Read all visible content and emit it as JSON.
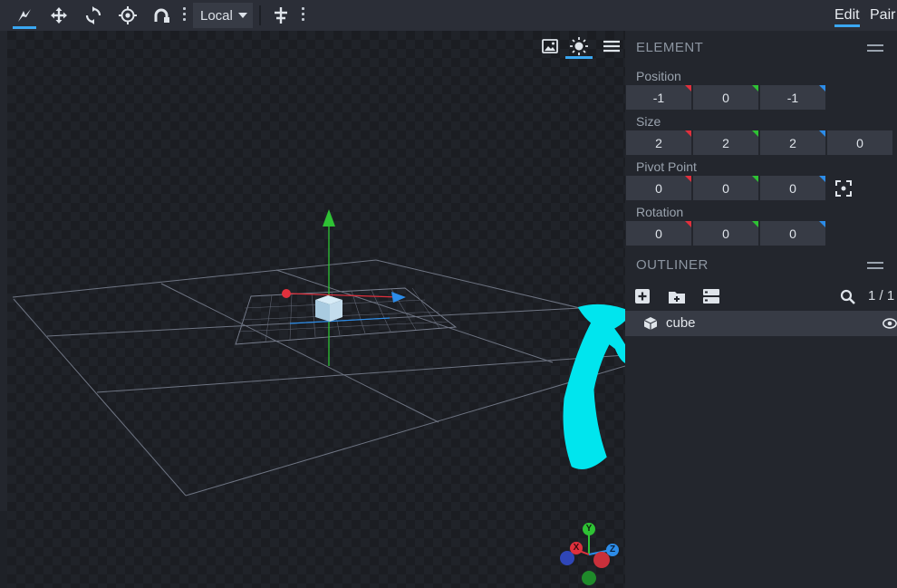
{
  "toolbar": {
    "tools": [
      {
        "name": "vertex-snap-tool"
      },
      {
        "name": "move-tool"
      },
      {
        "name": "rotate-tool"
      },
      {
        "name": "pivot-tool"
      },
      {
        "name": "resize-tool"
      }
    ],
    "space_select": "Local",
    "modes": [
      {
        "label": "Edit",
        "active": true
      },
      {
        "label": "Pair",
        "active": false
      }
    ]
  },
  "element_panel": {
    "title": "ELEMENT",
    "position": {
      "label": "Position",
      "values": [
        "-1",
        "0",
        "-1"
      ]
    },
    "size": {
      "label": "Size",
      "values": [
        "2",
        "2",
        "2",
        "0"
      ]
    },
    "pivot": {
      "label": "Pivot Point",
      "values": [
        "0",
        "0",
        "0"
      ]
    },
    "rotation": {
      "label": "Rotation",
      "values": [
        "0",
        "0",
        "0"
      ]
    }
  },
  "outliner": {
    "title": "OUTLINER",
    "count": "1 / 1",
    "items": [
      {
        "label": "cube"
      }
    ]
  },
  "gizmo": {
    "x": "X",
    "y": "Y",
    "z": "Z"
  },
  "colors": {
    "accent": "#3aa7f2",
    "axis_x": "#e0303d",
    "axis_y": "#2ec234",
    "axis_z": "#2c8ce8",
    "annotation": "#00e5ee"
  }
}
